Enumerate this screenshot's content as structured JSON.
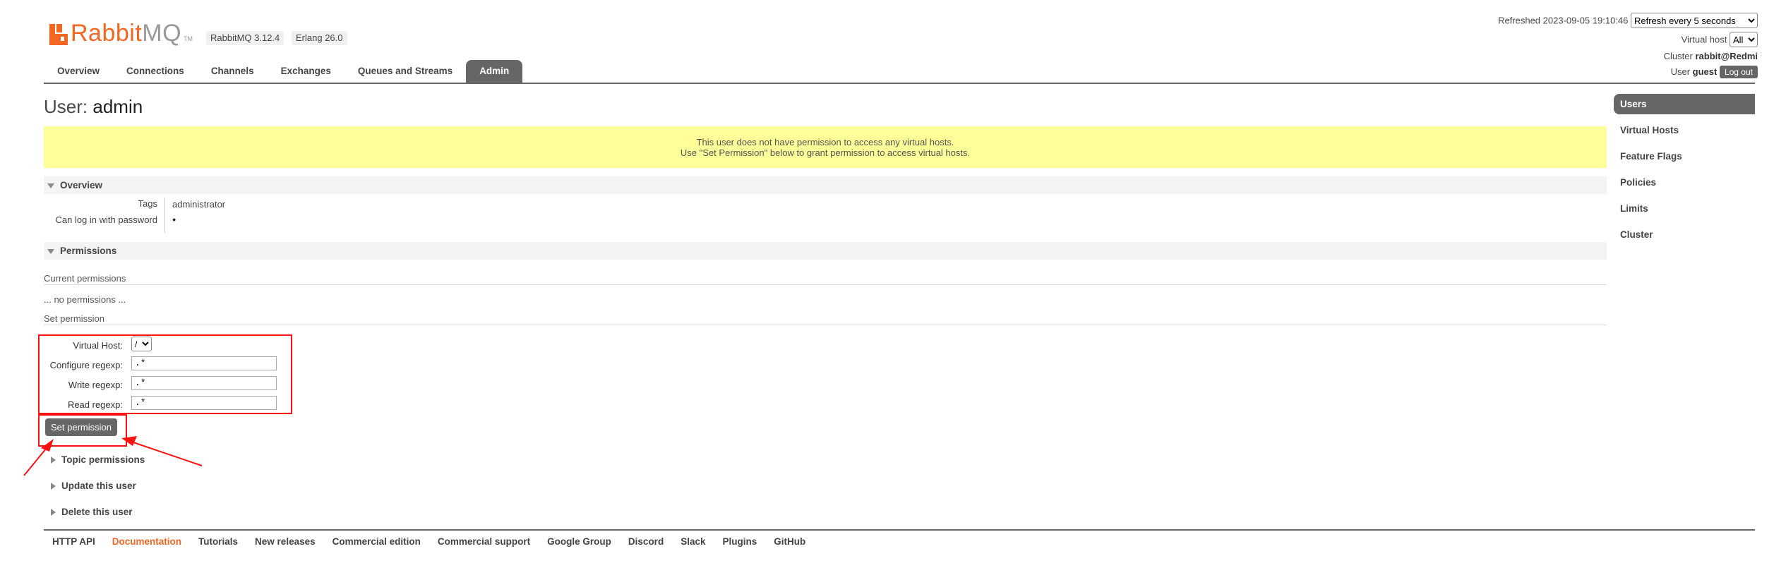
{
  "header": {
    "logo_rabbit": "Rabbit",
    "logo_mq": "MQ",
    "logo_tm": "TM",
    "version_rabbitmq": "RabbitMQ 3.12.4",
    "version_erlang": "Erlang 26.0",
    "refreshed_label": "Refreshed 2023-09-05 19:10:46",
    "refresh_option": "Refresh every 5 seconds",
    "vhost_label": "Virtual host",
    "vhost_option": "All",
    "cluster_label": "Cluster",
    "cluster_value": "rabbit@Redmi",
    "user_label": "User",
    "user_value": "guest",
    "logout_label": "Log out"
  },
  "tabs": [
    {
      "label": "Overview"
    },
    {
      "label": "Connections"
    },
    {
      "label": "Channels"
    },
    {
      "label": "Exchanges"
    },
    {
      "label": "Queues and Streams"
    },
    {
      "label": "Admin",
      "active": true
    }
  ],
  "right_nav": [
    {
      "label": "Users",
      "active": true
    },
    {
      "label": "Virtual Hosts"
    },
    {
      "label": "Feature Flags"
    },
    {
      "label": "Policies"
    },
    {
      "label": "Limits"
    },
    {
      "label": "Cluster"
    }
  ],
  "page": {
    "title_prefix": "User:",
    "title_name": "admin",
    "warning_line1": "This user does not have permission to access any virtual hosts.",
    "warning_line2": "Use \"Set Permission\" below to grant permission to access virtual hosts."
  },
  "overview": {
    "heading": "Overview",
    "tags_label": "Tags",
    "tags_value": "administrator",
    "login_label": "Can log in with password",
    "login_value": "●"
  },
  "permissions": {
    "heading": "Permissions",
    "current_label": "Current permissions",
    "none_text": "... no permissions ...",
    "set_label": "Set permission",
    "vhost_label": "Virtual Host:",
    "vhost_value": "/",
    "configure_label": "Configure regexp:",
    "configure_value": ".*",
    "write_label": "Write regexp:",
    "write_value": ".*",
    "read_label": "Read regexp:",
    "read_value": ".*",
    "submit_label": "Set permission"
  },
  "collapsed_sections": [
    {
      "label": "Topic permissions"
    },
    {
      "label": "Update this user"
    },
    {
      "label": "Delete this user"
    }
  ],
  "footer": [
    {
      "label": "HTTP API"
    },
    {
      "label": "Documentation",
      "highlight": true
    },
    {
      "label": "Tutorials"
    },
    {
      "label": "New releases"
    },
    {
      "label": "Commercial edition"
    },
    {
      "label": "Commercial support"
    },
    {
      "label": "Google Group"
    },
    {
      "label": "Discord"
    },
    {
      "label": "Slack"
    },
    {
      "label": "Plugins"
    },
    {
      "label": "GitHub"
    }
  ],
  "colors": {
    "brand": "#f26722",
    "tab_active": "#666666",
    "warning_bg": "#ffff99",
    "annotation_red": "#ff1111"
  }
}
